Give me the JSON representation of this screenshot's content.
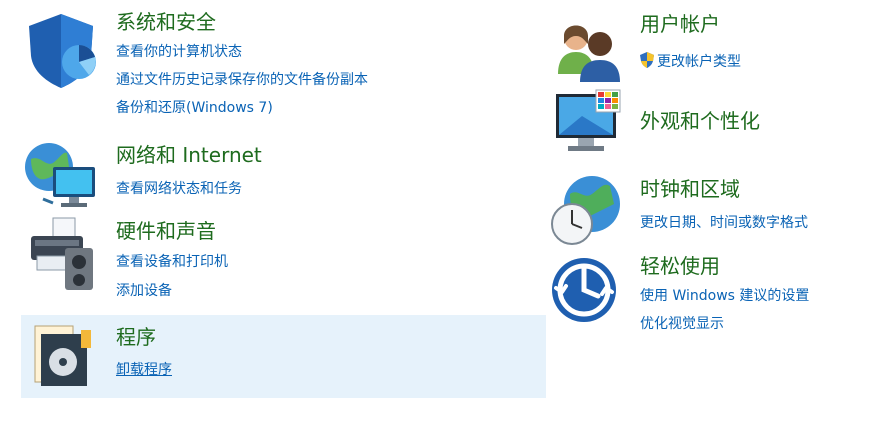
{
  "left": {
    "system": {
      "title": "系统和安全",
      "links": [
        "查看你的计算机状态",
        "通过文件历史记录保存你的文件备份副本",
        "备份和还原(Windows 7)"
      ]
    },
    "network": {
      "title": "网络和 Internet",
      "links": [
        "查看网络状态和任务"
      ]
    },
    "hardware": {
      "title": "硬件和声音",
      "links": [
        "查看设备和打印机",
        "添加设备"
      ]
    },
    "programs": {
      "title": "程序",
      "links": [
        "卸载程序"
      ]
    }
  },
  "right": {
    "users": {
      "title": "用户帐户",
      "links": [
        "更改帐户类型"
      ]
    },
    "appearance": {
      "title": "外观和个性化"
    },
    "clock": {
      "title": "时钟和区域",
      "links": [
        "更改日期、时间或数字格式"
      ]
    },
    "ease": {
      "title": "轻松使用",
      "links": [
        "使用 Windows 建议的设置",
        "优化视觉显示"
      ]
    }
  },
  "colors": {
    "title_green": "#1e6b1e",
    "link_blue": "#0a63b5",
    "highlight": "#e6f2fb"
  }
}
